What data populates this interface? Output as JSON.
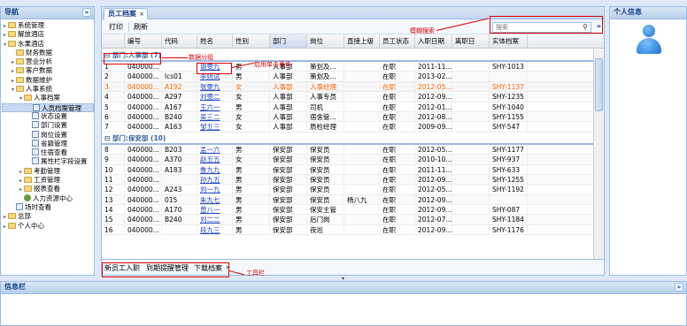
{
  "nav": {
    "title": "导航",
    "items": [
      {
        "label": "系统管理",
        "level": 0,
        "type": "folder",
        "toggle": "+"
      },
      {
        "label": "解放酒店",
        "level": 0,
        "type": "folder",
        "toggle": "+"
      },
      {
        "label": "水果酒店",
        "level": 0,
        "type": "folder",
        "toggle": "-"
      },
      {
        "label": "财务数据",
        "level": 1,
        "type": "folder",
        "toggle": ""
      },
      {
        "label": "营业分析",
        "level": 1,
        "type": "folder",
        "toggle": "+"
      },
      {
        "label": "客户数据",
        "level": 1,
        "type": "folder",
        "toggle": "+"
      },
      {
        "label": "数据维护",
        "level": 1,
        "type": "folder",
        "toggle": "+"
      },
      {
        "label": "人事系统",
        "level": 1,
        "type": "folder",
        "toggle": "-"
      },
      {
        "label": "人事档案",
        "level": 2,
        "type": "folder",
        "toggle": "-"
      },
      {
        "label": "人员档案管理",
        "level": 3,
        "type": "leaf",
        "toggle": "",
        "selected": true
      },
      {
        "label": "状态设置",
        "level": 3,
        "type": "leaf",
        "toggle": ""
      },
      {
        "label": "部门设置",
        "level": 3,
        "type": "leaf",
        "toggle": ""
      },
      {
        "label": "岗位设置",
        "level": 3,
        "type": "leaf",
        "toggle": ""
      },
      {
        "label": "省籍管理",
        "level": 3,
        "type": "leaf",
        "toggle": ""
      },
      {
        "label": "住宿查看",
        "level": 3,
        "type": "leaf",
        "toggle": ""
      },
      {
        "label": "属性栏字段设置",
        "level": 3,
        "type": "leaf",
        "toggle": ""
      },
      {
        "label": "考勤管理",
        "level": 2,
        "type": "folder",
        "toggle": "+"
      },
      {
        "label": "工资管理",
        "level": 2,
        "type": "folder",
        "toggle": "+"
      },
      {
        "label": "报表查看",
        "level": 2,
        "type": "folder",
        "toggle": "+"
      },
      {
        "label": "人力资源中心",
        "level": 2,
        "type": "people",
        "toggle": ""
      },
      {
        "label": "场时查看",
        "level": 1,
        "type": "leaf",
        "toggle": ""
      },
      {
        "label": "总部",
        "level": 0,
        "type": "folder",
        "toggle": "+"
      },
      {
        "label": "个人中心",
        "level": 0,
        "type": "folder",
        "toggle": "+"
      }
    ]
  },
  "center": {
    "tab_label": "员工档案",
    "toolbar": {
      "print_label": "打印",
      "refresh_label": "刷新"
    },
    "search": {
      "placeholder": "搜索",
      "more": "»"
    },
    "columns": [
      "",
      "编号",
      "代码",
      "姓名",
      "性别",
      "部门",
      "岗位",
      "直接上级",
      "员工状态",
      "入职日期",
      "离职日",
      "实体档案"
    ],
    "groups": [
      {
        "label": "部门:人事部 (7)",
        "rows": [
          {
            "n": "1",
            "id": "040000...",
            "code": "",
            "name": "谢雯九",
            "sex": "男",
            "dept": "人事部",
            "post": "策划及...",
            "boss": "",
            "status": "在职",
            "date": "2011-11...",
            "leave": "",
            "file": "SHY-1013"
          },
          {
            "n": "2",
            "id": "040000...",
            "code": "lcs01",
            "name": "李则试",
            "sex": "男",
            "dept": "人事部",
            "post": "策划及...",
            "boss": "",
            "status": "在职",
            "date": "2013-02...",
            "leave": "",
            "file": ""
          },
          {
            "n": "3",
            "id": "040000...",
            "code": "A192",
            "name": "张雯九",
            "sex": "女",
            "dept": "人事部",
            "post": "人事经理",
            "boss": "",
            "status": "在职",
            "date": "2012-05...",
            "leave": "",
            "file": "SHY-1137",
            "hl": true
          },
          {
            "n": "4",
            "id": "040000...",
            "code": "A297",
            "name": "刘雯二",
            "sex": "女",
            "dept": "人事部",
            "post": "人事专员",
            "boss": "",
            "status": "在职",
            "date": "2012-09...",
            "leave": "",
            "file": "SHY-1235"
          },
          {
            "n": "5",
            "id": "040000...",
            "code": "A167",
            "name": "王六一",
            "sex": "男",
            "dept": "人事部",
            "post": "司机",
            "boss": "",
            "status": "在职",
            "date": "2012-01...",
            "leave": "",
            "file": "SHY-1040"
          },
          {
            "n": "6",
            "id": "040000...",
            "code": "B240",
            "name": "吴三二",
            "sex": "女",
            "dept": "人事部",
            "post": "宿舍管...",
            "boss": "",
            "status": "在职",
            "date": "2012-08...",
            "leave": "",
            "file": "SHY-1155"
          },
          {
            "n": "7",
            "id": "040000...",
            "code": "A163",
            "name": "邹五三",
            "sex": "女",
            "dept": "人事部",
            "post": "质检经理",
            "boss": "",
            "status": "在职",
            "date": "2009-09...",
            "leave": "",
            "file": "SHY-547"
          }
        ]
      },
      {
        "label": "部门:保安部 (10)",
        "rows": [
          {
            "n": "8",
            "id": "040000...",
            "code": "B203",
            "name": "孟一六",
            "sex": "男",
            "dept": "保安部",
            "post": "保安员",
            "boss": "",
            "status": "在职",
            "date": "2012-05...",
            "leave": "",
            "file": "SHY-1177"
          },
          {
            "n": "9",
            "id": "040000...",
            "code": "A370",
            "name": "赵五五",
            "sex": "女",
            "dept": "保安部",
            "post": "保安员",
            "boss": "",
            "status": "在职",
            "date": "2010-10...",
            "leave": "",
            "file": "SHY-937"
          },
          {
            "n": "10",
            "id": "040000...",
            "code": "A183",
            "name": "鲁九九",
            "sex": "男",
            "dept": "保安部",
            "post": "保安员",
            "boss": "",
            "status": "在职",
            "date": "2011-11...",
            "leave": "",
            "file": "SHY-633"
          },
          {
            "n": "11",
            "id": "040000...",
            "code": "",
            "name": "孙九五",
            "sex": "男",
            "dept": "保安部",
            "post": "保安员",
            "boss": "",
            "status": "在职",
            "date": "2012-09...",
            "leave": "",
            "file": "SHY-1255"
          },
          {
            "n": "12",
            "id": "040000...",
            "code": "A243",
            "name": "刘一九",
            "sex": "男",
            "dept": "保安部",
            "post": "保安员",
            "boss": "",
            "status": "在职",
            "date": "2012-05...",
            "leave": "",
            "file": "SHY-1192"
          },
          {
            "n": "13",
            "id": "040000...",
            "code": "015",
            "name": "朱九七",
            "sex": "男",
            "dept": "保安部",
            "post": "保安员",
            "boss": "杨八九",
            "status": "在职",
            "date": "2012-09...",
            "leave": "",
            "file": ""
          },
          {
            "n": "14",
            "id": "040000...",
            "code": "A170",
            "name": "曾八一",
            "sex": "男",
            "dept": "保安部",
            "post": "保安主管",
            "boss": "",
            "status": "在职",
            "date": "2012-09...",
            "leave": "",
            "file": "SHY-087"
          },
          {
            "n": "15",
            "id": "040000...",
            "code": "B240",
            "name": "刘二二",
            "sex": "男",
            "dept": "保安部",
            "post": "后门岗",
            "boss": "",
            "status": "在职",
            "date": "2012-07...",
            "leave": "",
            "file": "SHY-1184"
          },
          {
            "n": "16",
            "id": "040000...",
            "code": "",
            "name": "段九三",
            "sex": "男",
            "dept": "保安部",
            "post": "夜巡",
            "boss": "",
            "status": "在职",
            "date": "2012-09...",
            "leave": "",
            "file": "SHY-1176"
          }
        ]
      }
    ],
    "bottom_toolbar": {
      "btn1": "新员工入职",
      "btn2": "到期提醒管理",
      "btn3": "下载档案",
      "more": "»"
    }
  },
  "profile": {
    "title": "个人信息"
  },
  "info": {
    "title": "信息栏"
  },
  "annotations": {
    "fuzzy_search": "模糊搜索",
    "data_group": "数据分组",
    "click_event": "启用单击事件",
    "toolbar": "工具栏"
  },
  "colors": {
    "accent": "#99bbe8",
    "header_text": "#15428b",
    "highlight_row": "#ff6600",
    "annotation": "#e00000"
  }
}
